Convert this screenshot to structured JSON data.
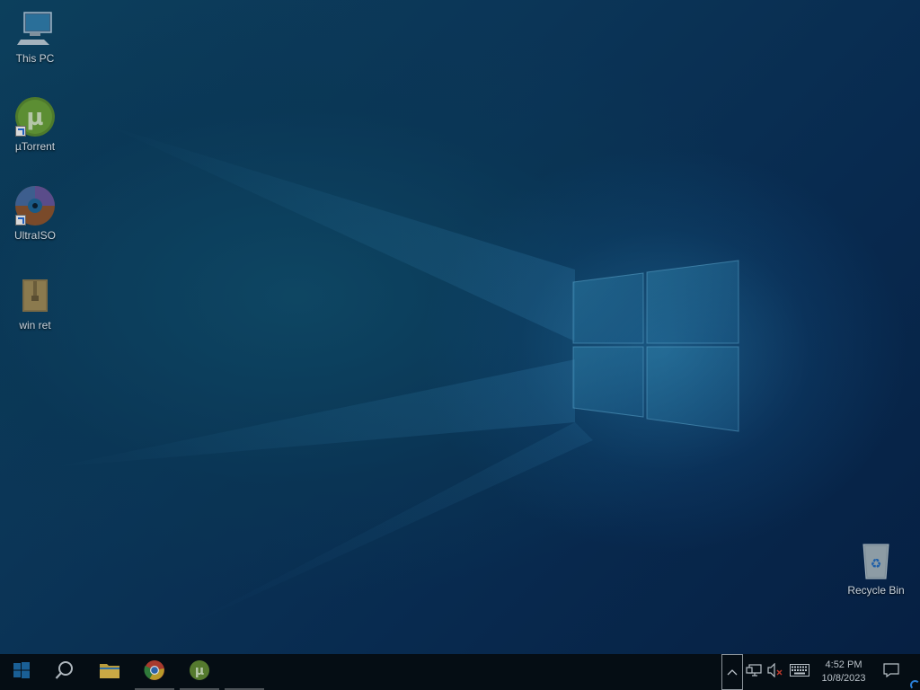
{
  "desktop": {
    "icons": [
      {
        "label": "This PC",
        "icon": "computer-icon"
      },
      {
        "label": "µTorrent",
        "icon": "utorrent-icon"
      },
      {
        "label": "UltraISO",
        "icon": "ultraiso-disc-icon"
      },
      {
        "label": "win ret",
        "icon": "archive-icon"
      },
      {
        "label": "Recycle Bin",
        "icon": "recycle-bin-icon"
      }
    ]
  },
  "taskbar": {
    "start": {
      "icon": "windows-start-icon"
    },
    "search": {
      "icon": "search-icon"
    },
    "pinned": [
      {
        "name": "File Explorer",
        "icon": "folder-icon"
      },
      {
        "name": "Google Chrome",
        "icon": "chrome-icon"
      },
      {
        "name": "µTorrent",
        "icon": "utorrent-icon"
      }
    ],
    "tray": {
      "overflow_icon": "chevron-up-icon",
      "network_icon": "network-icon",
      "volume_icon": "volume-muted-icon",
      "keyboard_icon": "touch-keyboard-icon",
      "notification_icon": "action-center-icon"
    },
    "clock": {
      "time": "4:52 PM",
      "date": "10/8/2023"
    }
  },
  "colors": {
    "taskbar_bg": "#050d14",
    "desktop_bg": "#0b3557",
    "accent": "#2b7fd6"
  }
}
